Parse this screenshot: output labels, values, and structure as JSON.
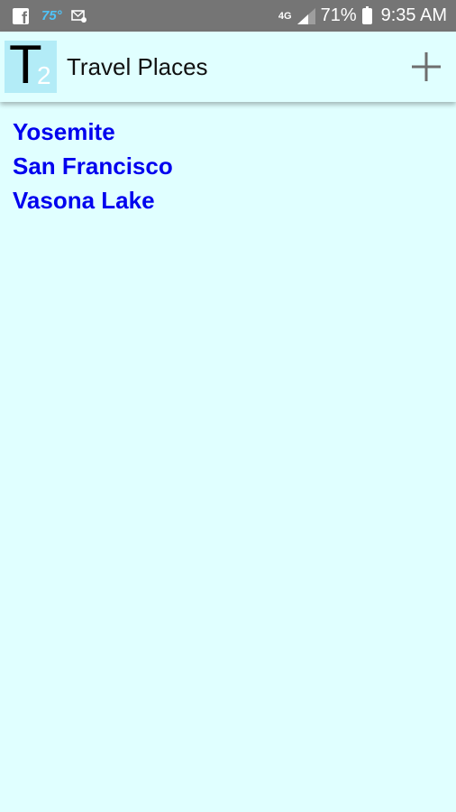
{
  "status_bar": {
    "temperature": "75°",
    "network": "4G",
    "battery_percent": "71%",
    "time": "9:35 AM",
    "icons": [
      "facebook-icon",
      "message-icon",
      "signal-icon",
      "battery-charging-icon"
    ]
  },
  "app_bar": {
    "logo_letter": "T",
    "logo_sub": "2",
    "title": "Travel Places",
    "add_icon": "plus-icon"
  },
  "places": [
    {
      "name": "Yosemite"
    },
    {
      "name": "San Francisco"
    },
    {
      "name": "Vasona Lake"
    }
  ],
  "colors": {
    "background": "#e0ffff",
    "status_bar": "#757575",
    "link": "#0000ee",
    "logo_bg": "#b3ecf7",
    "temperature": "#4fc3f7"
  }
}
